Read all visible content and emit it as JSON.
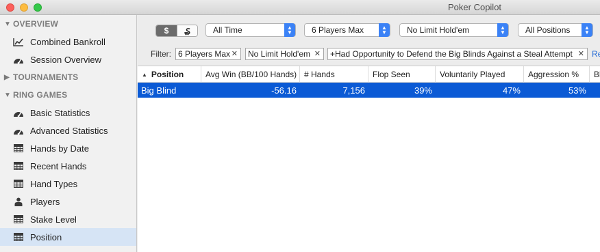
{
  "window": {
    "title": "Poker Copilot"
  },
  "sidebar": {
    "sections": [
      {
        "label": "OVERVIEW",
        "expanded": true
      },
      {
        "label": "TOURNAMENTS",
        "expanded": false
      },
      {
        "label": "RING GAMES",
        "expanded": true
      }
    ],
    "overview_items": [
      {
        "label": "Combined Bankroll",
        "icon": "line-chart-icon"
      },
      {
        "label": "Session Overview",
        "icon": "dashboard-gauge-icon"
      }
    ],
    "ring_items": [
      {
        "label": "Basic Statistics",
        "icon": "dashboard-gauge-icon"
      },
      {
        "label": "Advanced Statistics",
        "icon": "dashboard-gauge-icon"
      },
      {
        "label": "Hands by Date",
        "icon": "table-grid-icon"
      },
      {
        "label": "Recent Hands",
        "icon": "table-grid-icon"
      },
      {
        "label": "Hand Types",
        "icon": "table-grid-icon"
      },
      {
        "label": "Players",
        "icon": "person-icon"
      },
      {
        "label": "Stake Level",
        "icon": "table-grid-icon"
      },
      {
        "label": "Position",
        "icon": "table-grid-icon",
        "selected": true
      }
    ]
  },
  "toolbar": {
    "currency_toggle": {
      "on_label": "$",
      "off_label": "₷"
    },
    "time_filter": "All Time",
    "table_size_filter": "6 Players Max",
    "game_filter": "No Limit Hold'em",
    "position_filter": "All Positions"
  },
  "filters": {
    "label": "Filter:",
    "chips": [
      "6 Players Max",
      "No Limit Hold'em",
      "+Had Opportunity to Defend the Big Blinds Against a Steal Attempt"
    ],
    "reset_label": "Re"
  },
  "table": {
    "columns": [
      "Position",
      "Avg Win (BB/100 Hands)",
      "# Hands",
      "Flop Seen",
      "Voluntarily Played",
      "Aggression %",
      "Bl"
    ],
    "rows": [
      [
        "Big Blind",
        "-56.16",
        "7,156",
        "39%",
        "47%",
        "53%",
        ""
      ]
    ]
  },
  "colors": {
    "selection": "#0b5ad5",
    "sidebar_selected": "#d6e4f5",
    "accent": "#3b82f6"
  }
}
